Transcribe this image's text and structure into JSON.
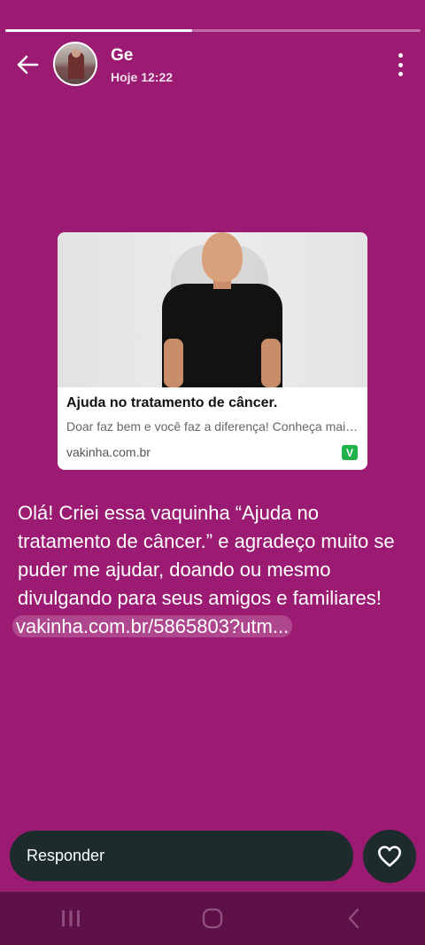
{
  "story": {
    "progress": 0.45
  },
  "header": {
    "name": "Ge",
    "time": "Hoje 12:22",
    "back_icon": "arrow-left-icon",
    "more_icon": "more-vertical-icon"
  },
  "link_preview": {
    "title": "Ajuda no tratamento de câncer.",
    "description": "Doar faz bem e você faz a diferença! Conheça mais sobre esta vaquinha",
    "domain": "vakinha.com.br",
    "logo_text": "V",
    "logo_color": "#1fb14a"
  },
  "message": {
    "text": "Olá! Criei essa vaquinha “Ajuda no tratamento de câncer.” e agradeço muito se puder me ajudar, doando ou mesmo divulgando para seus amigos e familiares!",
    "link": "vakinha.com.br/5865803?utm..."
  },
  "reply": {
    "placeholder": "Responder",
    "heart_icon": "heart-icon"
  },
  "colors": {
    "background": "#9b1a72",
    "input_background": "#1d2b2c",
    "nav_background": "#5d1146"
  },
  "navbar": {
    "recents_icon": "recents-icon",
    "home_icon": "home-icon",
    "back_icon": "back-chevron-icon"
  }
}
